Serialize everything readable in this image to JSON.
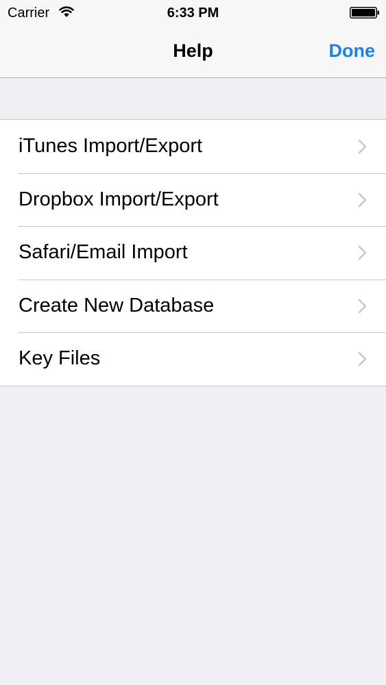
{
  "status_bar": {
    "carrier": "Carrier",
    "time": "6:33 PM",
    "wifi_icon": "wifi-icon",
    "battery_icon": "battery-full-icon"
  },
  "nav": {
    "title": "Help",
    "done_label": "Done",
    "accent_color": "#1a82f0"
  },
  "help_items": [
    {
      "label": "iTunes Import/Export",
      "icon": "chevron-right-icon"
    },
    {
      "label": "Dropbox Import/Export",
      "icon": "chevron-right-icon"
    },
    {
      "label": "Safari/Email Import",
      "icon": "chevron-right-icon"
    },
    {
      "label": "Create New Database",
      "icon": "chevron-right-icon"
    },
    {
      "label": "Key Files",
      "icon": "chevron-right-icon"
    }
  ]
}
